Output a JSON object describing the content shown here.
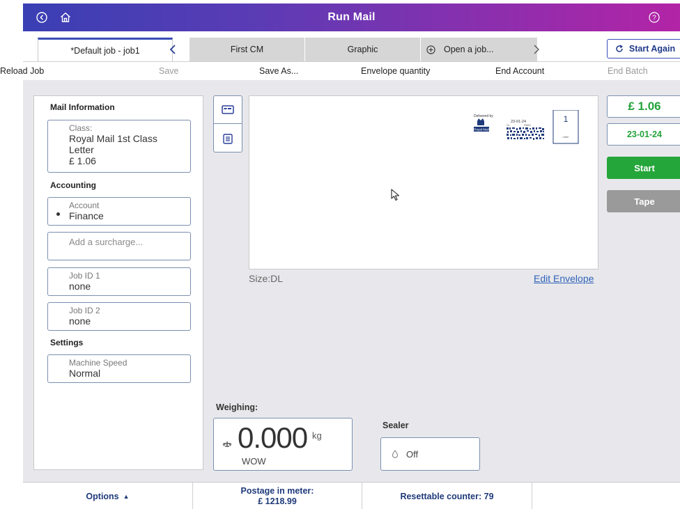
{
  "titlebar": {
    "title": "Run Mail",
    "back_icon": "back-circle-icon",
    "home_icon": "home-icon",
    "help_icon": "help-circle-icon"
  },
  "tabs": {
    "active": "*Default job - job1",
    "first_cm": "First CM",
    "graphic": "Graphic",
    "open_job": "Open a job...",
    "start_again": "Start Again"
  },
  "actions": {
    "reload_job": "Reload Job",
    "save": "Save",
    "save_as": "Save As...",
    "envelope_quantity": "Envelope quantity",
    "end_account": "End Account",
    "end_batch": "End Batch"
  },
  "left_panel": {
    "mail_info_title": "Mail Information",
    "class_label": "Class:",
    "class_line1": "Royal Mail 1st Class",
    "class_line2": "Letter",
    "class_price": "£ 1.06",
    "accounting_title": "Accounting",
    "account_label": "Account",
    "account_value": "Finance",
    "surcharge_placeholder": "Add a surcharge...",
    "job_id1_label": "Job ID 1",
    "job_id1_value": "none",
    "job_id2_label": "Job ID 2",
    "job_id2_value": "none",
    "settings_title": "Settings",
    "speed_label": "Machine Speed",
    "speed_value": "Normal"
  },
  "envelope": {
    "size": "Size:DL",
    "edit": "Edit Envelope",
    "indicia": {
      "delivered_by": "Delivered by",
      "brand": "Royal Mail",
      "date": "23-01-24",
      "code_left": "Ch",
      "code_right": "FMAS",
      "class_number": "1",
      "class_type": "Letter"
    }
  },
  "right_controls": {
    "price": "£ 1.06",
    "date": "23-01-24",
    "start": "Start",
    "tape": "Tape"
  },
  "weighing": {
    "title": "Weighing:",
    "weight": "0.000",
    "unit": "kg",
    "mode": "WOW"
  },
  "sealer": {
    "title": "Sealer",
    "state": "Off"
  },
  "footer": {
    "options": "Options",
    "postage_label": "Postage in meter:",
    "postage_value": "£ 1218.99",
    "counter": "Resettable counter: 79"
  },
  "colors": {
    "title_gradient_start": "#3a3fb4",
    "title_gradient_end": "#b324a6",
    "accent_green": "#25a63a",
    "link_blue": "#2f62b8",
    "disabled_gray": "#9a9a9a"
  }
}
